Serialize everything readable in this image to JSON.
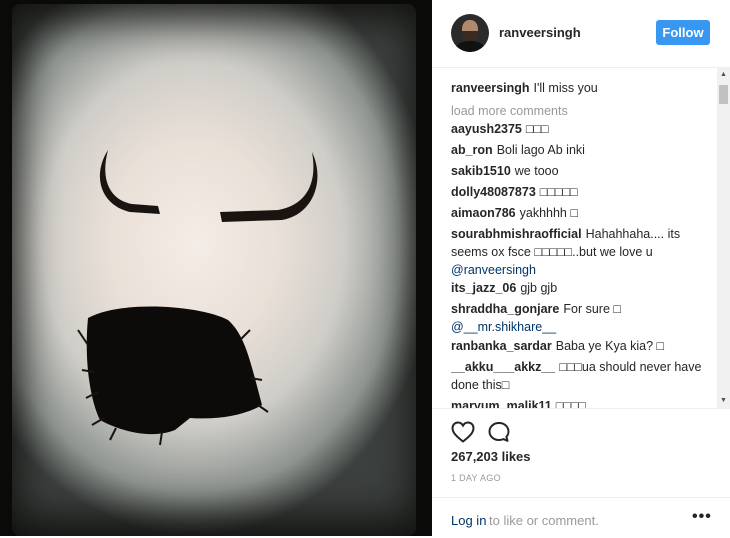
{
  "post": {
    "username": "ranveersingh",
    "follow_label": "Follow",
    "caption_user": "ranveersingh",
    "caption_text": "I'll miss you",
    "load_more": "load more comments",
    "comments": [
      {
        "user": "aayush2375",
        "text": "□□□"
      },
      {
        "user": "ab_ron",
        "text": "Boli lago Ab inki"
      },
      {
        "user": "sakib1510",
        "text": "we tooo"
      },
      {
        "user": "dolly48087873",
        "text": "□□□□□"
      },
      {
        "user": "aimaon786",
        "text": "yakhhhh □"
      },
      {
        "user": "sourabhmishraofficial",
        "text": "Hahahhaha.... its seems ox fsce □□□□□..but we love u",
        "mention": "@ranveersingh"
      },
      {
        "user": "its_jazz_06",
        "text": "gjb gjb"
      },
      {
        "user": "shraddha_gonjare",
        "text": "For sure □",
        "mention": "@__mr.shikhare__"
      },
      {
        "user": "ranbanka_sardar",
        "text": "Baba ye Kya kia? □"
      },
      {
        "user": "__akku___akkz__",
        "text": "□□□ua should never have done this□"
      },
      {
        "user": "maryum_malik11",
        "text": "□□□□"
      }
    ],
    "likes": "267,203 likes",
    "time": "1 DAY AGO",
    "login_link": "Log in",
    "login_rest": "to like or comment.",
    "more_label": "•••"
  },
  "icons": {
    "like": "heart-icon",
    "comment": "comment-icon",
    "more": "more-options-icon"
  },
  "colors": {
    "follow_bg": "#3897f0",
    "link": "#003569",
    "muted": "#999999"
  }
}
